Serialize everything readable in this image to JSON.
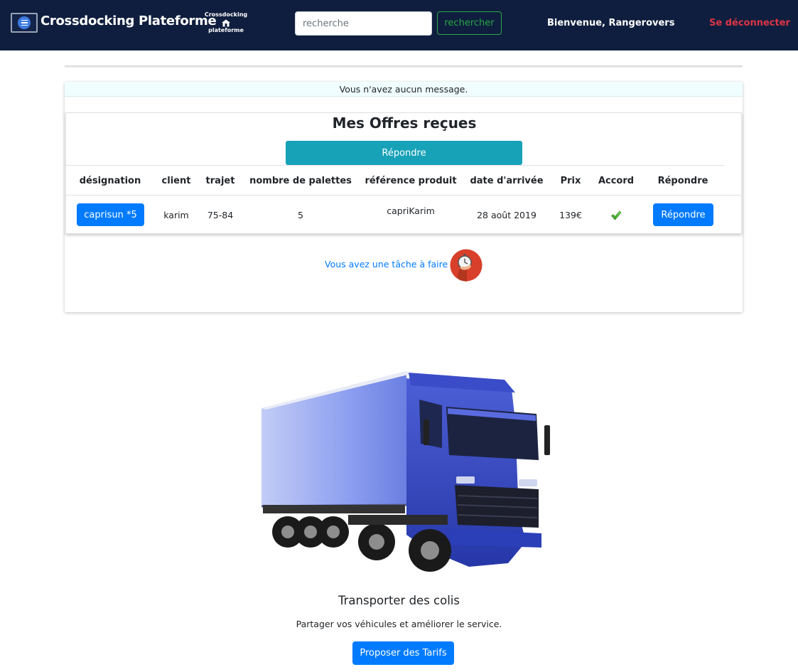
{
  "navbar": {
    "brand": "Crossdocking Plateforme",
    "logo_line1": "Crossdocking",
    "logo_line2": "plateforme",
    "search_placeholder": "recherche",
    "search_button": "rechercher",
    "welcome": "Bienvenue, Rangerovers",
    "logout": "Se déconnecter"
  },
  "messages": {
    "notice": "Vous n'avez aucun message."
  },
  "offers": {
    "title": "Mes Offres reçues",
    "respond_button": "Répondre",
    "columns": [
      "désignation",
      "client",
      "trajet",
      "nombre de palettes",
      "référence produit",
      "date d'arrivée",
      "Prix",
      "Accord",
      "Répondre"
    ],
    "rows": [
      {
        "designation": "caprisun *5",
        "client": "karim",
        "trajet": "75-84",
        "palettes": "5",
        "reference": "capriKarim",
        "date": "28 août 2019",
        "prix": "139€",
        "accord": true,
        "repondre": "Répondre"
      }
    ]
  },
  "task": {
    "link_text": "Vous avez une tâche à faire"
  },
  "hero": {
    "title": "Transporter des colis",
    "subtitle": "Partager vos véhicules et améliorer le service.",
    "button": "Proposer des Tarifs"
  },
  "colors": {
    "navbar_bg": "#0f1e3e",
    "primary": "#007bff",
    "info": "#17a2b8",
    "success": "#28a745",
    "danger": "#dc3545"
  }
}
